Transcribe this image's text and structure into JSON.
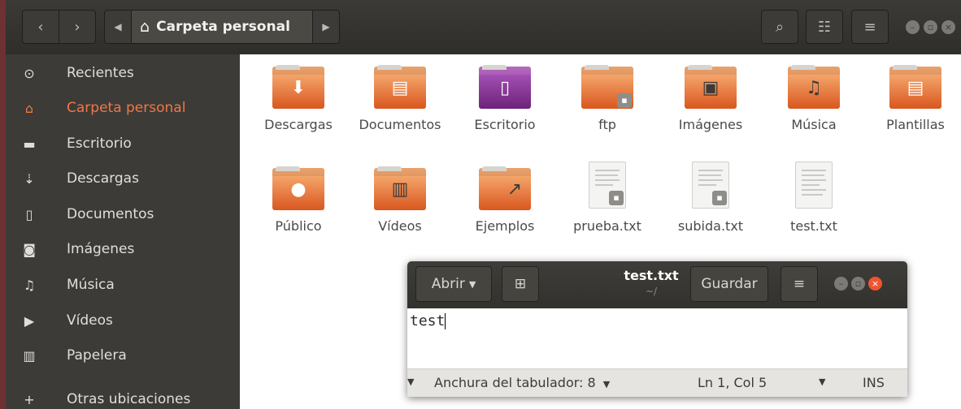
{
  "file_manager": {
    "location": "Carpeta personal",
    "sidebar": {
      "items": [
        {
          "label": "Recientes",
          "icon": "clock-icon",
          "glyph": "⊙"
        },
        {
          "label": "Carpeta personal",
          "icon": "home-icon",
          "glyph": "⌂"
        },
        {
          "label": "Escritorio",
          "icon": "desktop-folder-icon",
          "glyph": "▬"
        },
        {
          "label": "Descargas",
          "icon": "download-icon",
          "glyph": "⇣"
        },
        {
          "label": "Documentos",
          "icon": "document-icon",
          "glyph": "▯"
        },
        {
          "label": "Imágenes",
          "icon": "camera-icon",
          "glyph": "◙"
        },
        {
          "label": "Música",
          "icon": "music-icon",
          "glyph": "♫"
        },
        {
          "label": "Vídeos",
          "icon": "video-icon",
          "glyph": "▶"
        },
        {
          "label": "Papelera",
          "icon": "trash-icon",
          "glyph": "▥"
        },
        {
          "label": "Otras ubicaciones",
          "icon": "plus-icon",
          "glyph": "+"
        }
      ]
    },
    "files": [
      {
        "name": "Descargas",
        "kind": "folder",
        "emblem": "download-emblem-icon",
        "glyph": "⬇"
      },
      {
        "name": "Documentos",
        "kind": "folder",
        "emblem": "document-emblem-icon",
        "glyph": "▤"
      },
      {
        "name": "Escritorio",
        "kind": "folder-desktop",
        "emblem": "desktop-emblem-icon",
        "glyph": "▯"
      },
      {
        "name": "ftp",
        "kind": "folder",
        "emblem": "lock-emblem-icon",
        "glyph": "🔒"
      },
      {
        "name": "Imágenes",
        "kind": "folder",
        "emblem": "picture-emblem-icon",
        "glyph": "▣"
      },
      {
        "name": "Música",
        "kind": "folder",
        "emblem": "music-emblem-icon",
        "glyph": "♫"
      },
      {
        "name": "Plantillas",
        "kind": "folder",
        "emblem": "template-emblem-icon",
        "glyph": "▤"
      },
      {
        "name": "Público",
        "kind": "folder",
        "emblem": "user-emblem-icon",
        "glyph": "👤"
      },
      {
        "name": "Vídeos",
        "kind": "folder",
        "emblem": "film-emblem-icon",
        "glyph": "▥"
      },
      {
        "name": "Ejemplos",
        "kind": "folder",
        "emblem": "link-emblem-icon",
        "glyph": "↗"
      },
      {
        "name": "prueba.txt",
        "kind": "text-file",
        "emblem": "lock-emblem-icon"
      },
      {
        "name": "subida.txt",
        "kind": "text-file",
        "emblem": "lock-emblem-icon"
      },
      {
        "name": "test.txt",
        "kind": "text-file",
        "emblem": ""
      }
    ]
  },
  "gedit": {
    "open_label": "Abrir",
    "save_label": "Guardar",
    "title": "test.txt",
    "subtitle": "~/",
    "content": "test",
    "status": {
      "tab_width": "Anchura del tabulador: 8",
      "position": "Ln 1, Col 5",
      "mode": "INS"
    }
  },
  "colors": {
    "accent": "#f07746",
    "folder": "#e0672b",
    "sidebar_bg": "#3c3b37",
    "close_button": "#f0542f"
  }
}
